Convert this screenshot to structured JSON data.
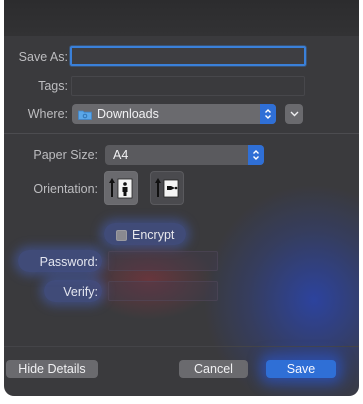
{
  "form": {
    "save_as": {
      "label": "Save As:",
      "value": ""
    },
    "tags": {
      "label": "Tags:",
      "value": ""
    },
    "where": {
      "label": "Where:",
      "value": "Downloads",
      "icon": "folder-icon"
    }
  },
  "print": {
    "paper_size": {
      "label": "Paper Size:",
      "value": "A4"
    },
    "orientation": {
      "label": "Orientation:",
      "options": [
        "portrait-icon",
        "landscape-icon"
      ],
      "selected": "portrait"
    }
  },
  "security": {
    "encrypt_label": "Encrypt",
    "encrypt_checked": false,
    "password_label": "Password:",
    "verify_label": "Verify:"
  },
  "footer": {
    "hide_details": "Hide Details",
    "cancel": "Cancel",
    "save": "Save"
  },
  "colors": {
    "accent": "#2f6fd6",
    "background": "#3a3a3d",
    "focus_ring": "#3a80d9"
  }
}
